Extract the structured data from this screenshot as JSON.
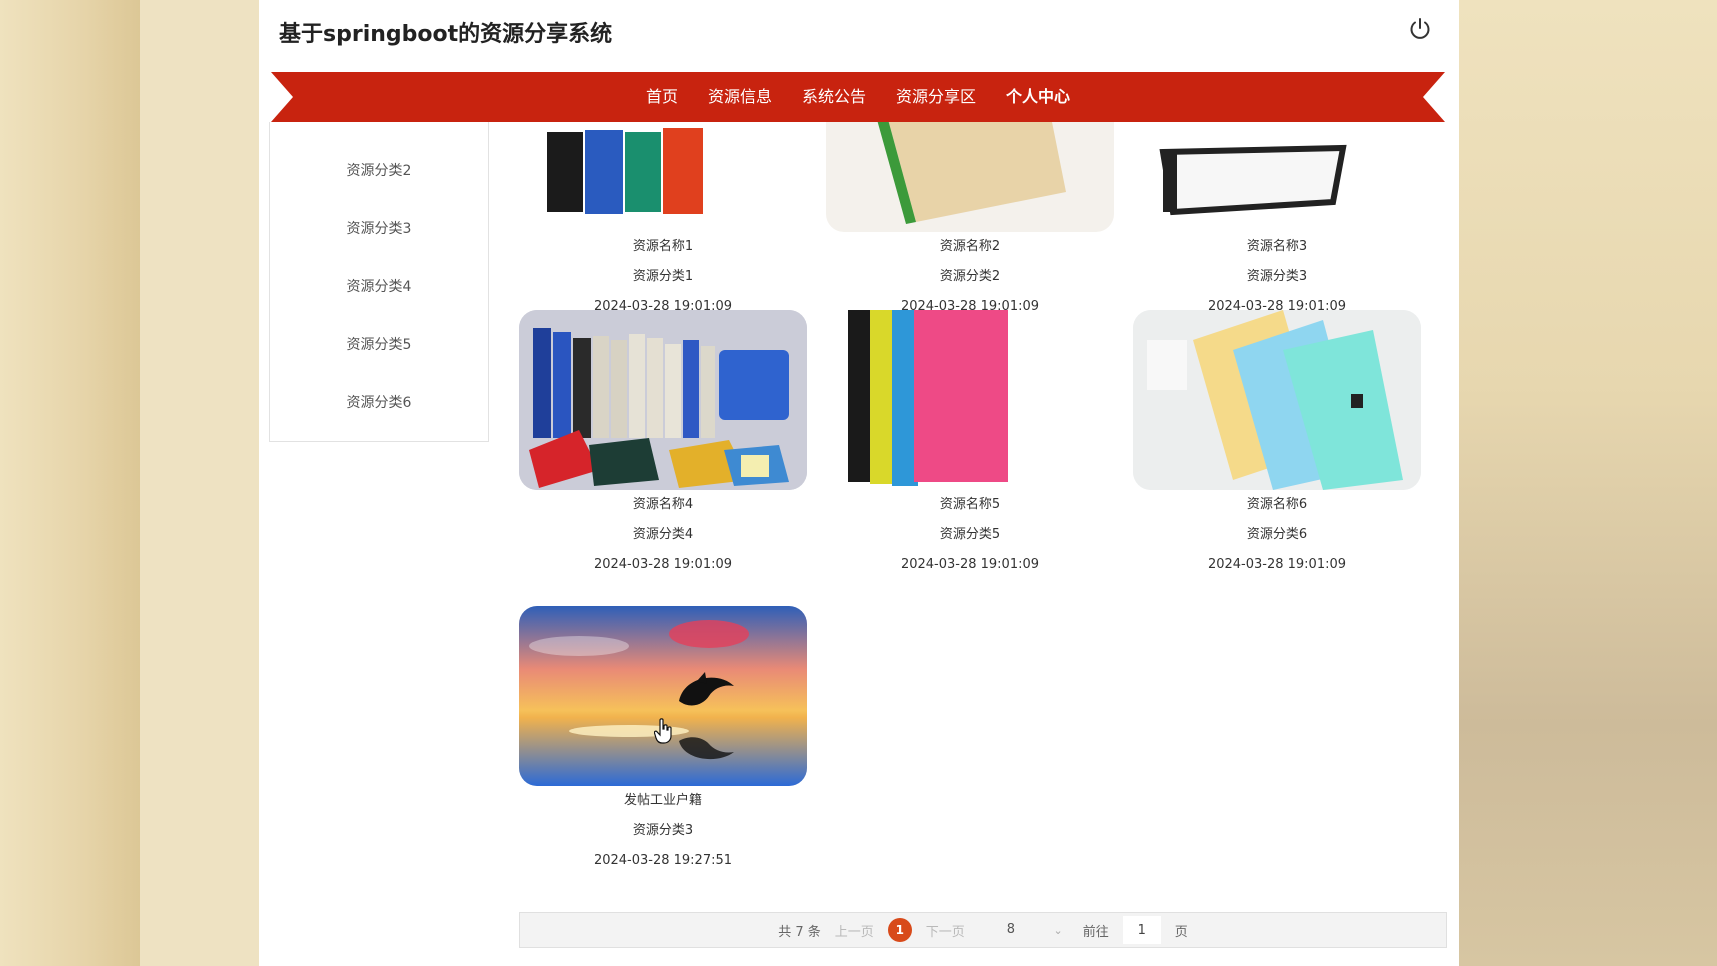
{
  "site": {
    "title": "基于springboot的资源分享系统"
  },
  "nav": {
    "items": [
      {
        "label": "首页"
      },
      {
        "label": "资源信息"
      },
      {
        "label": "系统公告"
      },
      {
        "label": "资源分享区"
      },
      {
        "label": "个人中心"
      }
    ],
    "active": "个人中心",
    "bar_color": "#c8230f"
  },
  "sidebar": {
    "items": [
      {
        "label": "资源分类2"
      },
      {
        "label": "资源分类3"
      },
      {
        "label": "资源分类4"
      },
      {
        "label": "资源分类5"
      },
      {
        "label": "资源分类6"
      }
    ]
  },
  "cards": [
    {
      "name": "资源名称1",
      "category": "资源分类1",
      "time": "2024-03-28 19:01:09",
      "image": "colorful-binders"
    },
    {
      "name": "资源名称2",
      "category": "资源分类2",
      "time": "2024-03-28 19:01:09",
      "image": "beige-notebook"
    },
    {
      "name": "资源名称3",
      "category": "资源分类3",
      "time": "2024-03-28 19:01:09",
      "image": "black-binder"
    },
    {
      "name": "资源名称4",
      "category": "资源分类4",
      "time": "2024-03-28 19:01:09",
      "image": "office-binders-set"
    },
    {
      "name": "资源名称5",
      "category": "资源分类5",
      "time": "2024-03-28 19:01:09",
      "image": "color-folders"
    },
    {
      "name": "资源名称6",
      "category": "资源分类6",
      "time": "2024-03-28 19:01:09",
      "image": "pastel-folders"
    },
    {
      "name": "发帖工业户籍",
      "category": "资源分类3",
      "time": "2024-03-28 19:27:51",
      "image": "dolphin-sunset"
    }
  ],
  "pagination": {
    "total": "共 7 条",
    "prev": "上一页",
    "current": "1",
    "next": "下一页",
    "page_size": "8",
    "goto_label": "前往",
    "goto_value": "1",
    "page_suffix": "页"
  },
  "icons": {
    "power": "power-icon",
    "dropdown": "chevron-down-icon",
    "cursor": "hand-cursor-icon"
  }
}
